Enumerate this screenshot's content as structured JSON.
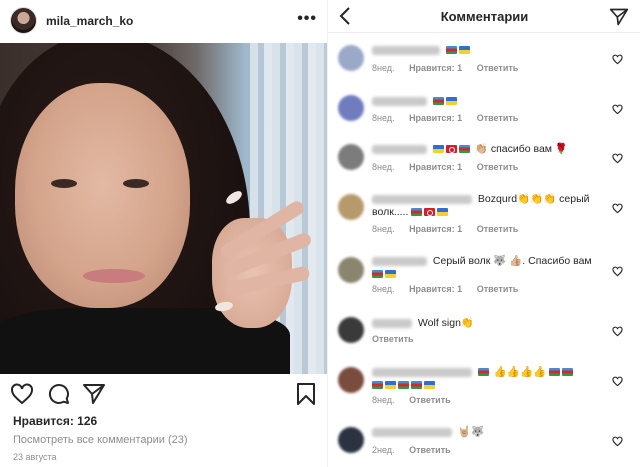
{
  "post": {
    "username": "mila_march_ko",
    "more_icon": "•••",
    "likes": "Нравится: 126",
    "view_all": "Посмотреть все комментарии (23)",
    "date": "23 августа",
    "icons": [
      "heart-icon",
      "comment-icon",
      "share-icon",
      "bookmark-icon"
    ]
  },
  "comments_panel": {
    "title": "Комментарии",
    "items": [
      {
        "text": "",
        "time": "8нед.",
        "likes": "Нравится: 1",
        "reply": "Ответить",
        "flags": [
          "az",
          "ua"
        ]
      },
      {
        "text": "",
        "time": "8нед.",
        "likes": "Нравится: 1",
        "reply": "Ответить",
        "flags": [
          "az",
          "ua"
        ]
      },
      {
        "text": "👏🏼 спасибо вам 🌹",
        "time": "8нед.",
        "likes": "Нравится: 1",
        "reply": "Ответить",
        "flags": [
          "ua",
          "tr",
          "az"
        ]
      },
      {
        "text": "Bozqurd👏👏👏 серый волк.....",
        "time": "8нед.",
        "likes": "Нравится: 1",
        "reply": "Ответить",
        "flags": [
          "az",
          "tr",
          "ua"
        ]
      },
      {
        "text": "Серый волк 🐺 👍🏼. Спасибо вам",
        "time": "8нед.",
        "likes": "Нравится: 1",
        "reply": "Ответить",
        "flags": [
          "az",
          "ua"
        ]
      },
      {
        "text": "Wolf sign👏",
        "time": "8нед.",
        "likes": "",
        "reply": "Ответить",
        "flags": []
      },
      {
        "text": "👍👍👍👍",
        "time": "8нед.",
        "likes": "",
        "reply": "Ответить",
        "flags": [
          "az",
          "az",
          "az",
          "ua",
          "az",
          "az",
          "ua"
        ]
      },
      {
        "text": "🤘🏼🐺",
        "time": "2нед.",
        "likes": "",
        "reply": "Ответить",
        "flags": []
      }
    ]
  },
  "colors": {
    "text": "#262626",
    "muted": "#8e8e8e"
  }
}
